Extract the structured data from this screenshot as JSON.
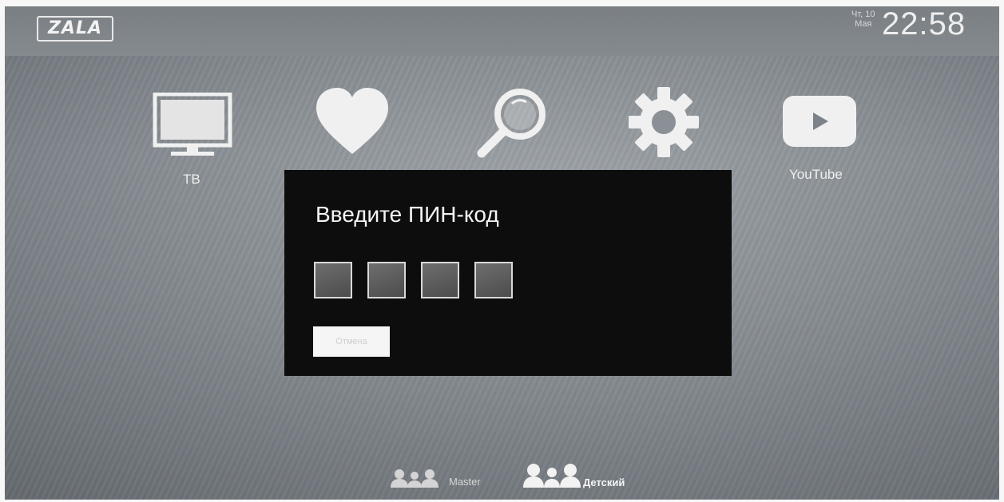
{
  "header": {
    "logo_text": "ZALA",
    "date_line1": "Чт, 10",
    "date_line2": "Мая",
    "time": "22:58"
  },
  "menu": {
    "items": [
      {
        "label": "ТВ",
        "icon": "tv-icon"
      },
      {
        "label": "",
        "icon": "heart-icon"
      },
      {
        "label": "",
        "icon": "search-icon"
      },
      {
        "label": "",
        "icon": "gear-icon"
      },
      {
        "label": "YouTube",
        "icon": "youtube-icon"
      }
    ]
  },
  "pin_dialog": {
    "title": "Введите ПИН-код",
    "pin_boxes": [
      "",
      "",
      "",
      ""
    ],
    "cancel_label": "Отмена"
  },
  "profiles": [
    {
      "label": "Master",
      "icon": "users-icon"
    },
    {
      "label": "Детский",
      "icon": "users-icon"
    }
  ],
  "colors": {
    "background": "#8d9398",
    "dialog": "#0d0d0d",
    "icon": "#f0f0f0"
  }
}
